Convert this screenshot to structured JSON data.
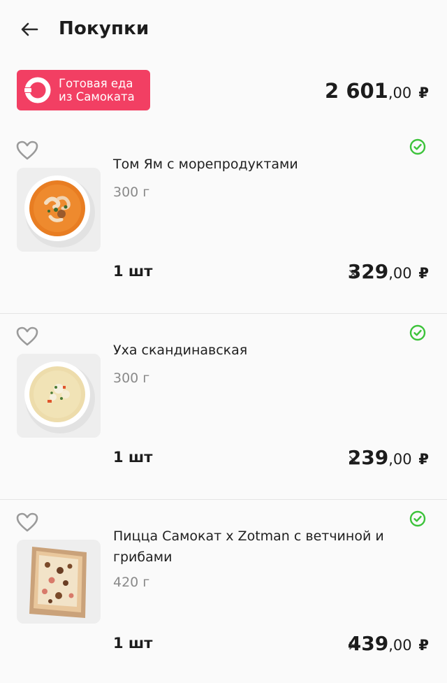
{
  "header": {
    "title": "Покупки",
    "back_icon": "arrow-left-icon"
  },
  "store": {
    "badge_line1": "Готовая еда",
    "badge_line2": "из Самоката",
    "badge_color": "#f23f63",
    "total_main": "2 601",
    "total_cents": ",00",
    "total_currency": "₽"
  },
  "items": [
    {
      "name": "Том Ям с морепродуктами",
      "weight": "300 г",
      "qty": "1 шт",
      "times": "×",
      "price_main": "329",
      "price_cents": ",00",
      "currency": "₽",
      "favorite_icon": "heart-outline-icon",
      "status_icon": "check-circle-icon",
      "status_color": "#3cc33a"
    },
    {
      "name": "Уха скандинавская",
      "weight": "300 г",
      "qty": "1 шт",
      "times": "×",
      "price_main": "239",
      "price_cents": ",00",
      "currency": "₽",
      "favorite_icon": "heart-outline-icon",
      "status_icon": "check-circle-icon",
      "status_color": "#3cc33a"
    },
    {
      "name": "Пицца Самокат x Zotman с ветчиной и грибами",
      "weight": "420 г",
      "qty": "1 шт",
      "times": "×",
      "price_main": "439",
      "price_cents": ",00",
      "currency": "₽",
      "favorite_icon": "heart-outline-icon",
      "status_icon": "check-circle-icon",
      "status_color": "#3cc33a"
    }
  ]
}
